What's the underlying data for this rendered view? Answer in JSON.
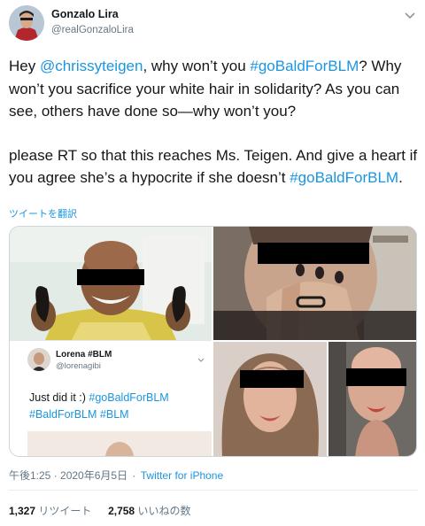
{
  "tweet": {
    "author": {
      "name": "Gonzalo Lira",
      "handle": "@realGonzaloLira"
    },
    "menu_icon": "chevron-down-icon",
    "paragraph1": {
      "t1": "Hey ",
      "mention": "@chrissyteigen",
      "t2": ", why won’t you ",
      "hashtag": "#goBaldForBLM",
      "t3": "? Why won’t you sacrifice your white hair in solidarity? As you can see, others have done so—why won’t you?"
    },
    "paragraph2": {
      "t1": "please RT so that this reaches Ms. Teigen. And give a heart if you agree she’s a hypocrite if she doesn’t ",
      "hashtag": "#goBaldForBLM",
      "t2": "."
    },
    "translate_label": "ツイートを翻訳",
    "embedded": {
      "name": "Lorena #BLM",
      "handle": "@lorenagibi",
      "text1": "Just did it :) ",
      "hashtag1": "#goBaldForBLM",
      "hashtag2": "#BaldForBLM",
      "hashtag3": "#BLM"
    },
    "timestamp": "午後1:25 · 2020年6月5日",
    "separator": "·",
    "source": "Twitter for iPhone",
    "retweets": {
      "count": "1,327",
      "label": "リツイート"
    },
    "likes": {
      "count": "2,758",
      "label": "いいねの数"
    }
  },
  "colors": {
    "link": "#1b95e0",
    "text": "#14171a",
    "muted": "#657786",
    "border": "#ccd6dd"
  }
}
